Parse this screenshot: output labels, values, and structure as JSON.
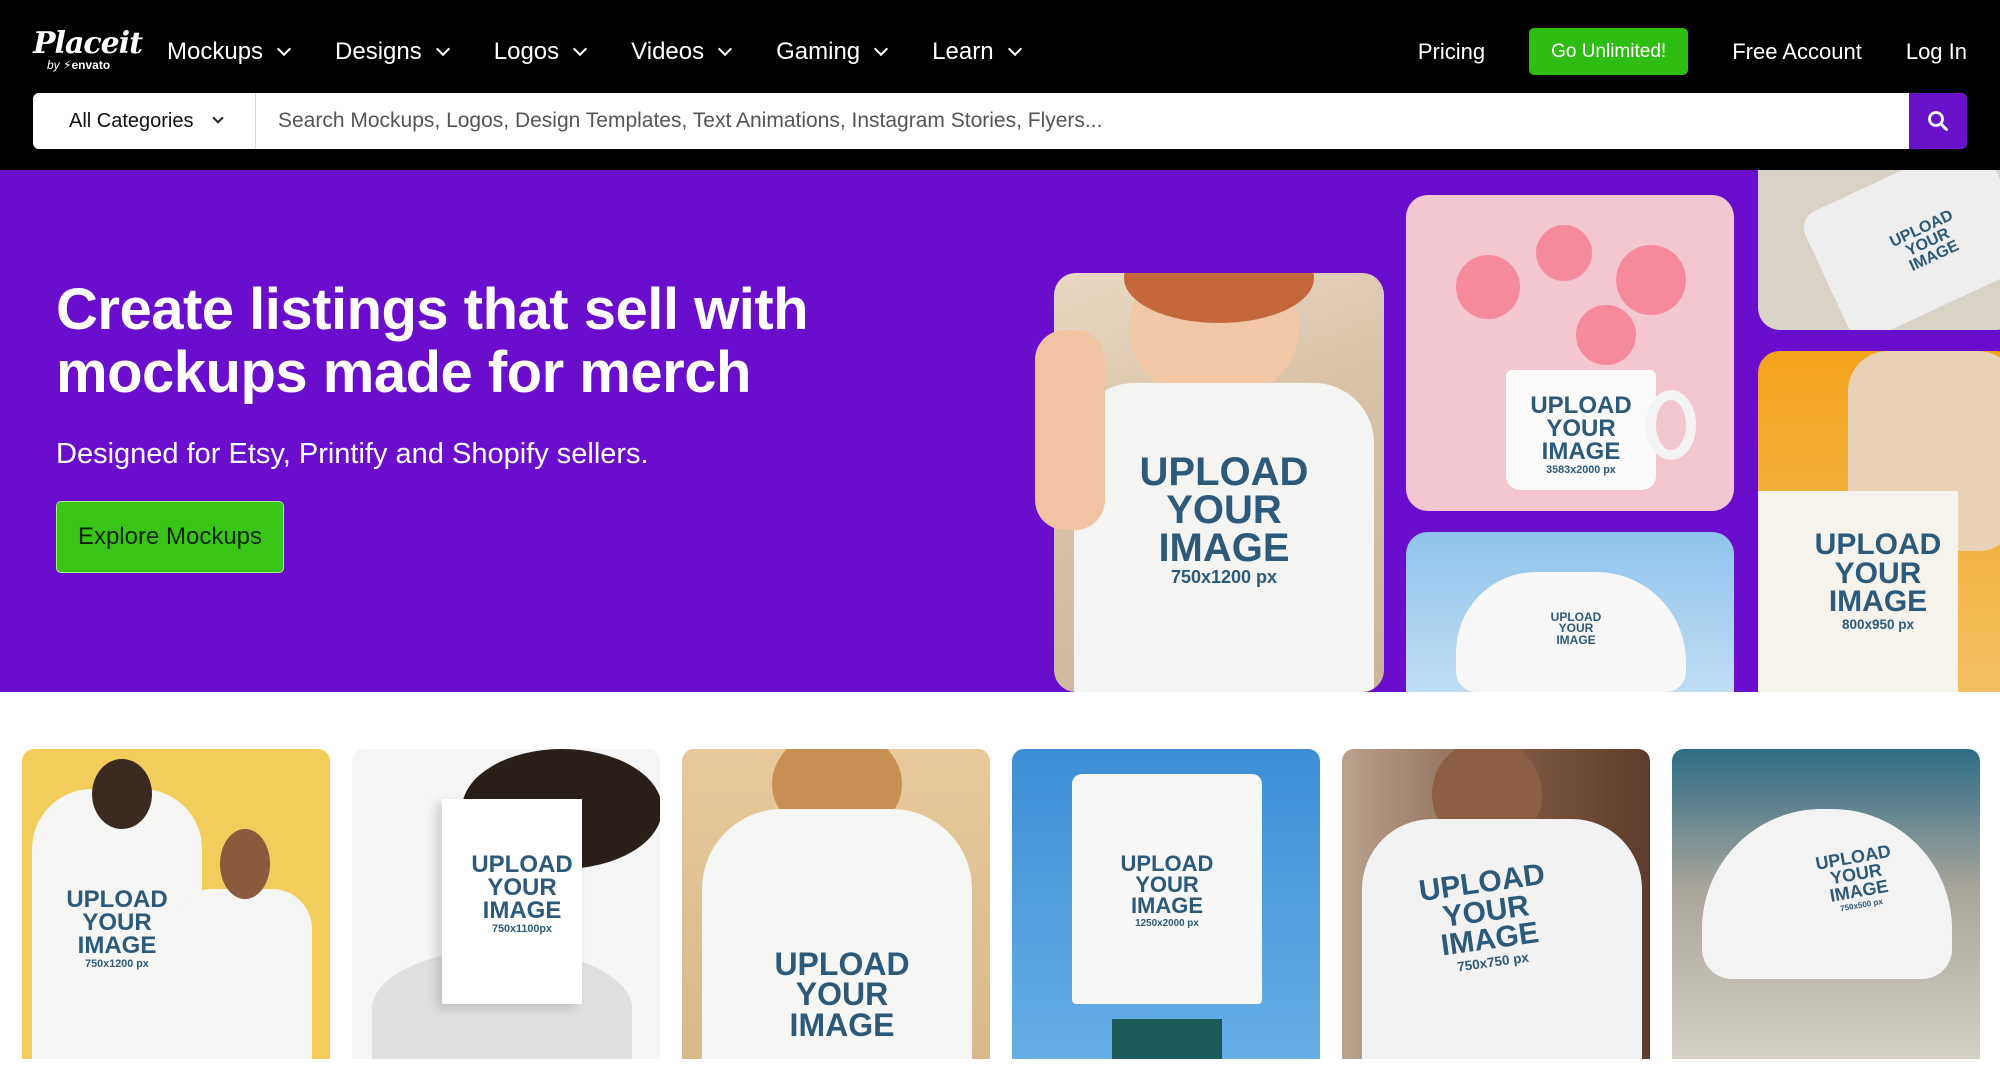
{
  "header": {
    "logo": {
      "name": "Placeit",
      "by": "by",
      "brand": "envato"
    },
    "nav": [
      {
        "label": "Mockups"
      },
      {
        "label": "Designs"
      },
      {
        "label": "Logos"
      },
      {
        "label": "Videos"
      },
      {
        "label": "Gaming"
      },
      {
        "label": "Learn"
      }
    ],
    "pricing_label": "Pricing",
    "unlimited_label": "Go Unlimited!",
    "free_account_label": "Free Account",
    "login_label": "Log In"
  },
  "search": {
    "category_label": "All Categories",
    "placeholder": "Search Mockups, Logos, Design Templates, Text Animations, Instagram Stories, Flyers...",
    "search_icon": "search-icon"
  },
  "hero": {
    "title": "Create listings that sell with mockups made for merch",
    "subtitle": "Designed for Etsy, Printify and Shopify sellers.",
    "cta_label": "Explore Mockups",
    "tiles": [
      {
        "line1": "UPLOAD",
        "line2": "YOUR",
        "line3": "IMAGE",
        "px": "750x1200 px"
      },
      {
        "line1": "UPLOAD",
        "line2": "YOUR",
        "line3": "IMAGE",
        "px": "3583x2000 px"
      },
      {
        "line1": "UPLOAD",
        "line2": "YOUR",
        "line3": "IMAGE",
        "px": "800x950 px"
      },
      {
        "line1": "UPLOAD",
        "line2": "YOUR",
        "line3": "IMAGE",
        "px": ""
      },
      {
        "line1": "UPLOAD",
        "line2": "YOUR",
        "line3": "IMAGE",
        "px": ""
      }
    ]
  },
  "cards": [
    {
      "line1": "UPLOAD",
      "line2": "YOUR",
      "line3": "IMAGE",
      "px": "750x1200 px"
    },
    {
      "line1": "UPLOAD",
      "line2": "YOUR",
      "line3": "IMAGE",
      "px": "750x1100px"
    },
    {
      "line1": "UPLOAD",
      "line2": "YOUR",
      "line3": "IMAGE",
      "px": ""
    },
    {
      "line1": "UPLOAD",
      "line2": "YOUR",
      "line3": "IMAGE",
      "px": "1250x2000 px"
    },
    {
      "line1": "UPLOAD",
      "line2": "YOUR",
      "line3": "IMAGE",
      "px": "750x750 px"
    },
    {
      "line1": "UPLOAD",
      "line2": "YOUR",
      "line3": "IMAGE",
      "px": "750x500 px"
    }
  ],
  "colors": {
    "accent_purple": "#6a0dcc",
    "cta_green": "#38c515",
    "topbar": "#000000"
  }
}
